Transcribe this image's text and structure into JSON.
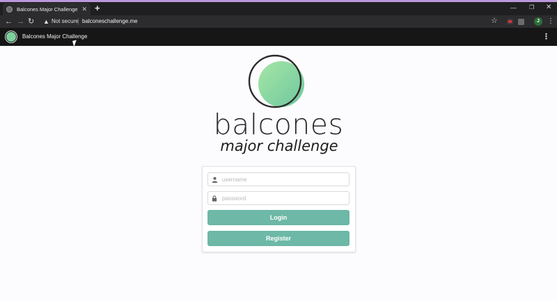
{
  "browser": {
    "tab": {
      "title": "Balcones Major Challenge",
      "close_icon": "close-icon",
      "favicon": "globe-icon"
    },
    "new_tab_icon": "plus-icon",
    "window_controls": {
      "minimize": "minimize-icon",
      "maximize": "restore-icon",
      "close": "close-icon"
    },
    "address_bar": {
      "security_label": "Not secure",
      "url": "balconeschallenge.me"
    },
    "profile_initial": "J"
  },
  "site_nav": {
    "brand": "Balcones Major Challenge",
    "menu_icon": "kebab-menu-icon"
  },
  "hero": {
    "name": "balcones",
    "subtitle": "major challenge"
  },
  "login_form": {
    "username_placeholder": "username",
    "password_placeholder": "password",
    "login_label": "Login",
    "register_label": "Register"
  },
  "colors": {
    "accent_strip": "#b998dc",
    "button": "#6db8a6",
    "logo_green": "#7fcf9d",
    "page_background": "#fcfbfd",
    "site_navbar": "#161616"
  }
}
